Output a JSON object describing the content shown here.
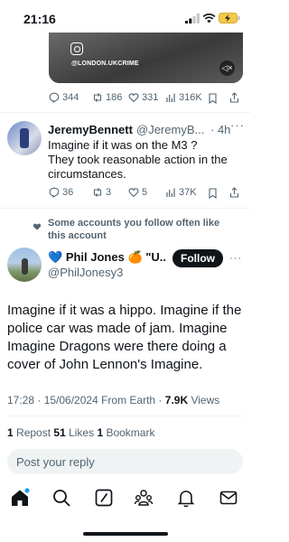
{
  "status_bar": {
    "time": "21:16"
  },
  "video": {
    "watermark": "@LONDON.UKCRIME"
  },
  "top_actions": {
    "replies": "344",
    "reposts": "186",
    "likes": "331",
    "views": "316K"
  },
  "reply_tweet": {
    "name": "JeremyBennett",
    "handle": "@JeremyB...",
    "time": "· 4h",
    "more": "···",
    "lines": [
      "Imagine if it was on the M3 ?",
      "They took reasonable action in the",
      "circumstances."
    ],
    "replies": "36",
    "reposts": "3",
    "likes": "5",
    "views": "37K"
  },
  "context": {
    "lines": [
      "Some accounts you follow often like",
      "this account"
    ]
  },
  "main_tweet": {
    "name": "Phil Jones 🍊 \"U...",
    "handle": "@PhilJonesy3",
    "follow_label": "Follow",
    "more": "···",
    "lines": [
      "Imagine if it was a hippo.  Imagine if the",
      "police car was made of jam.  Imagine",
      "Imagine Dragons were there doing a",
      "cover of John Lennon's Imagine."
    ],
    "timestamp": "17:28 · 15/06/2024 From Earth · ",
    "views_count": "7.9K",
    "views_label": " Views",
    "repost_count": "1",
    "repost_label": " Repost  ",
    "likes_count": "51",
    "likes_label": " Likes  ",
    "bookmark_count": "1",
    "bookmark_label": " Bookmark"
  },
  "reply_input": {
    "placeholder": "Post your reply"
  },
  "colors": {
    "text": "#0f1419",
    "muted": "#536471",
    "accent": "#1d9bf0"
  },
  "nav": {
    "items": [
      "home-icon",
      "search-icon",
      "grok-icon",
      "communities-icon",
      "notifications-icon",
      "messages-icon"
    ]
  }
}
